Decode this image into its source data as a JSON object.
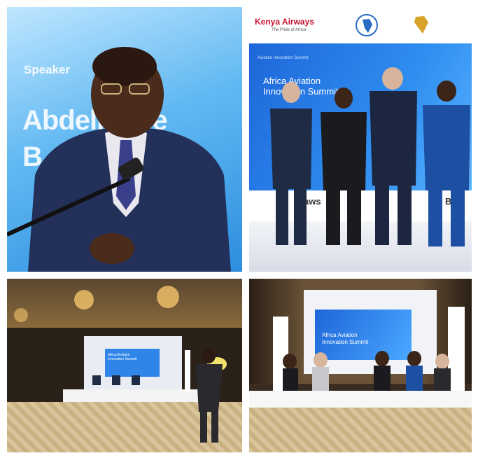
{
  "photos": [
    {
      "id": "speaker-photo"
    },
    {
      "id": "group-photo"
    },
    {
      "id": "hall-photo"
    },
    {
      "id": "panel-photo"
    }
  ],
  "speaker_screen": {
    "label": "Speaker",
    "name_line1": "Abdelmane",
    "name_line2": "B"
  },
  "group_backdrop": {
    "logo_text": "Kenya Airways",
    "logo_sub": "The Pride of Africa",
    "small_text": "Aviation Innovation Summit",
    "title_line1": "Africa Aviation",
    "title_line2": "Innovation Summit",
    "sponsors": [
      "aws",
      "BUS"
    ]
  },
  "hall_screen": {
    "title_line1": "Africa Aviation",
    "title_line2": "Innovation Summit"
  },
  "panel_screen": {
    "title_line1": "Africa Aviation",
    "title_line2": "Innovation Summit"
  },
  "colors": {
    "accent_blue": "#2f86e8",
    "kenya_red": "#c8102e",
    "floor": "#d9c59c"
  }
}
